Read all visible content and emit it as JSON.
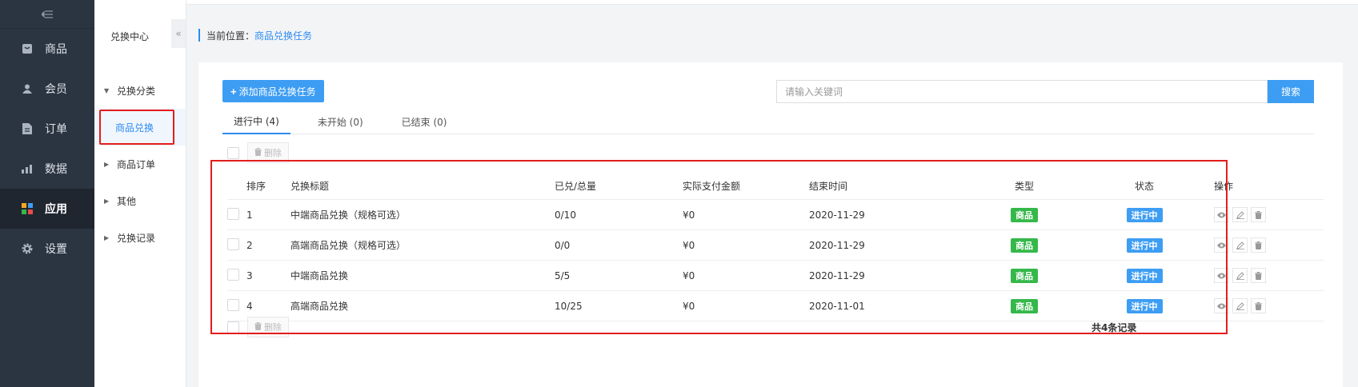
{
  "sidebar": {
    "collapse_icon": "menu-fold-icon",
    "items": [
      {
        "label": "商品",
        "icon": "goods-icon"
      },
      {
        "label": "会员",
        "icon": "user-icon"
      },
      {
        "label": "订单",
        "icon": "order-icon"
      },
      {
        "label": "数据",
        "icon": "chart-icon"
      },
      {
        "label": "应用",
        "icon": "apps-icon",
        "active": true
      },
      {
        "label": "设置",
        "icon": "gear-icon"
      }
    ]
  },
  "submenu": {
    "title": "兑换中心",
    "collapse_glyph": "«",
    "items": [
      {
        "label": "兑换分类",
        "expanded": true
      },
      {
        "label": "商品兑换",
        "active": true
      },
      {
        "label": "商品订单"
      },
      {
        "label": "其他"
      },
      {
        "label": "兑换记录"
      }
    ]
  },
  "breadcrumb": {
    "prefix": "当前位置：",
    "current": "商品兑换任务"
  },
  "toolbar": {
    "add_plus": "+",
    "add_label": "添加商品兑换任务",
    "search_placeholder": "请输入关键词",
    "search_label": "搜索"
  },
  "tabs": [
    {
      "label": "进行中 (4)",
      "active": true
    },
    {
      "label": "未开始 (0)"
    },
    {
      "label": "已结束 (0)"
    }
  ],
  "delete_label": "删除",
  "table": {
    "headers": [
      "排序",
      "兑换标题",
      "已兑/总量",
      "实际支付金额",
      "结束时间",
      "类型",
      "状态",
      "操作"
    ],
    "rows": [
      {
        "order": "1",
        "title": "中端商品兑换（规格可选）",
        "redeemed": "0/10",
        "amount": "¥0",
        "end": "2020-11-29",
        "type": "商品",
        "status": "进行中"
      },
      {
        "order": "2",
        "title": "高端商品兑换（规格可选）",
        "redeemed": "0/0",
        "amount": "¥0",
        "end": "2020-11-29",
        "type": "商品",
        "status": "进行中"
      },
      {
        "order": "3",
        "title": "中端商品兑换",
        "redeemed": "5/5",
        "amount": "¥0",
        "end": "2020-11-29",
        "type": "商品",
        "status": "进行中"
      },
      {
        "order": "4",
        "title": "高端商品兑换",
        "redeemed": "10/25",
        "amount": "¥0",
        "end": "2020-11-01",
        "type": "商品",
        "status": "进行中"
      }
    ]
  },
  "total": "共4条记录",
  "colors": {
    "accent": "#3d9df3",
    "type_badge": "#35b84a",
    "highlight": "#e31d1d",
    "sidebar_bg": "#2b3441"
  }
}
